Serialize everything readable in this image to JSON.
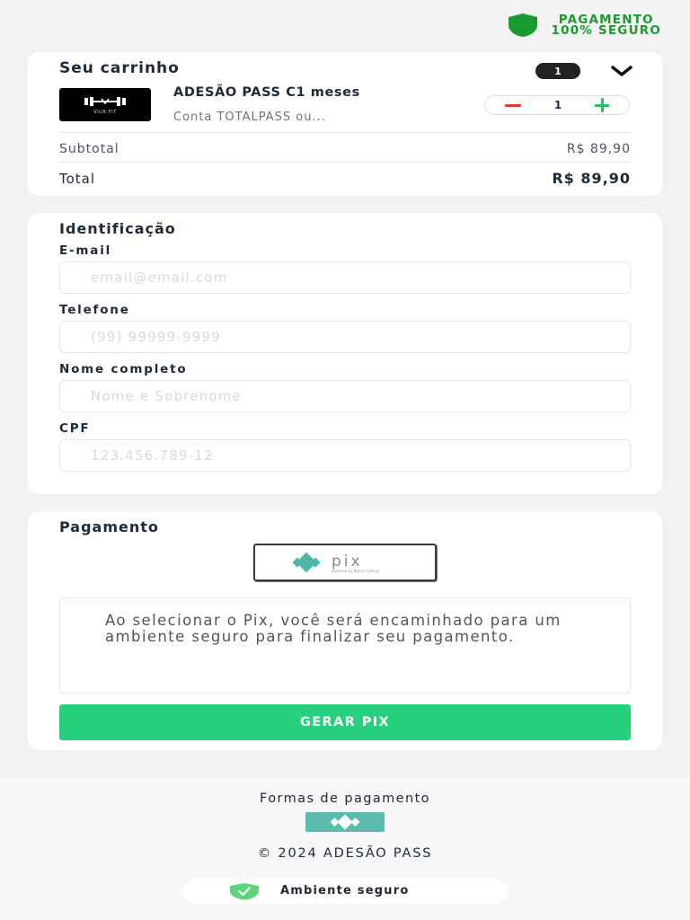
{
  "header": {
    "secure_line1": "PAGAMENTO",
    "secure_line2": "100% SEGURO",
    "icon": "shield-icon",
    "color": "#1a9b32"
  },
  "cart": {
    "title": "Seu carrinho",
    "item_count": "1",
    "toggle_icon": "chevron-down-icon",
    "product": {
      "image_text": "VIUR FIT",
      "name": "ADESÃO PASS C1 meses",
      "description": "Conta TOTALPASS ou...",
      "quantity": "1"
    },
    "subtotal_label": "Subtotal",
    "subtotal_value": "R$ 89,90",
    "total_label": "Total",
    "total_value": "R$ 89,90"
  },
  "identification": {
    "title": "Identificação",
    "fields": [
      {
        "label": "E-mail",
        "placeholder": "email@email.com"
      },
      {
        "label": "Telefone",
        "placeholder": "(99) 99999-9999"
      },
      {
        "label": "Nome completo",
        "placeholder": "Nome e Sobrenome"
      },
      {
        "label": "CPF",
        "placeholder": "123.456.789-12"
      }
    ]
  },
  "payment": {
    "title": "Pagamento",
    "method_logo": "pix",
    "method_sub": "powered by Banco Central",
    "info_text": "Ao selecionar o Pix, você será encaminhado para um ambiente seguro para finalizar seu pagamento.",
    "button_label": "GERAR PIX",
    "button_color": "#27d07d"
  },
  "footer": {
    "payment_methods_title": "Formas de pagamento",
    "copyright": "© 2024 ADESÃO PASS",
    "secure_label": "Ambiente seguro"
  }
}
